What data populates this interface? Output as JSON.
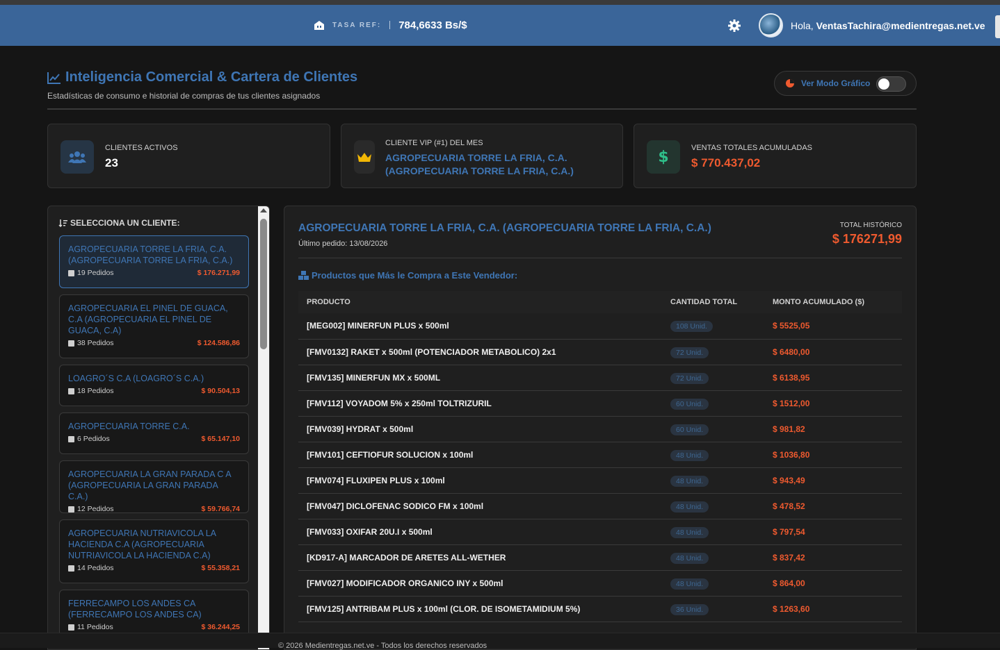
{
  "header": {
    "rate_label": "TASA REF:",
    "rate_value": "784,6633 Bs/$",
    "greeting": "Hola,",
    "user_email": "VentasTachira@medientregas.net.ve"
  },
  "page": {
    "title": "Inteligencia Comercial & Cartera de Clientes",
    "subtitle": "Estadísticas de consumo e historial de compras de tus clientes asignados",
    "toggle_label": "Ver Modo Gráfico",
    "toggle_on": false
  },
  "stats": {
    "clients_label": "CLIENTES ACTIVOS",
    "clients_value": "23",
    "vip_label": "CLIENTE VIP (#1) DEL MES",
    "vip_line1": "AGROPECUARIA TORRE LA FRIA, C.A.",
    "vip_line2": "(AGROPECUARIA TORRE LA FRIA, C.A.)",
    "sales_label": "VENTAS TOTALES ACUMULADAS",
    "sales_value": "$ 770.437,02"
  },
  "client_list": {
    "heading": "SELECCIONA UN CLIENTE:",
    "items": [
      {
        "name": "AGROPECUARIA TORRE LA FRIA, C.A. (AGROPECUARIA TORRE LA FRIA, C.A.)",
        "orders": "19 Pedidos",
        "amount": "$ 176.271,99"
      },
      {
        "name": "AGROPECUARIA EL PINEL DE GUACA, C.A (AGROPECUARIA EL PINEL DE GUACA, C.A)",
        "orders": "38 Pedidos",
        "amount": "$ 124.586,86"
      },
      {
        "name": "LOAGRO´S C.A (LOAGRO´S C.A.)",
        "orders": "18 Pedidos",
        "amount": "$ 90.504,13"
      },
      {
        "name": "AGROPECUARIA TORRE C.A.",
        "orders": "6 Pedidos",
        "amount": "$ 65.147,10"
      },
      {
        "name": "AGROPECUARIA LA GRAN PARADA C A (AGROPECUARIA LA GRAN PARADA C.A.)",
        "orders": "12 Pedidos",
        "amount": "$ 59.766,74"
      },
      {
        "name": "AGROPECUARIA NUTRIAVICOLA LA HACIENDA C.A (AGROPECUARIA NUTRIAVICOLA LA HACIENDA C.A)",
        "orders": "14 Pedidos",
        "amount": "$ 55.358,21"
      },
      {
        "name": "FERRECAMPO LOS ANDES CA (FERRECAMPO LOS ANDES CA)",
        "orders": "11 Pedidos",
        "amount": "$ 36.244,25"
      }
    ]
  },
  "detail": {
    "client_title": "AGROPECUARIA TORRE LA FRIA, C.A. (AGROPECUARIA TORRE LA FRIA, C.A.)",
    "last_order": "Último pedido: 13/08/2026",
    "total_label": "TOTAL HISTÓRICO",
    "total_value": "$ 176271,99",
    "products_heading": "Productos que Más le Compra a Este Vendedor:",
    "columns": [
      "PRODUCTO",
      "CANTIDAD TOTAL",
      "MONTO ACUMULADO ($)"
    ],
    "rows": [
      [
        "[MEG002] MINERFUN PLUS x 500ml",
        "108 Unid.",
        "$ 5525,05"
      ],
      [
        "[FMV0132] RAKET x 500ml (POTENCIADOR METABOLICO) 2x1",
        "72 Unid.",
        "$ 6480,00"
      ],
      [
        "[FMV135] MINERFUN MX x 500ML",
        "72 Unid.",
        "$ 6138,95"
      ],
      [
        "[FMV112] VOYADOM 5% x 250ml TOLTRIZURIL",
        "60 Unid.",
        "$ 1512,00"
      ],
      [
        "[FMV039] HYDRAT x 500ml",
        "60 Unid.",
        "$ 981,82"
      ],
      [
        "[FMV101] CEFTIOFUR SOLUCION x 100ml",
        "48 Unid.",
        "$ 1036,80"
      ],
      [
        "[FMV074] FLUXIPEN PLUS x 100ml",
        "48 Unid.",
        "$ 943,49"
      ],
      [
        "[FMV047] DICLOFENAC SODICO FM x 100ml",
        "48 Unid.",
        "$ 478,52"
      ],
      [
        "[FMV033] OXIFAR 20U.I x 500ml",
        "48 Unid.",
        "$ 797,54"
      ],
      [
        "[KD917-A] MARCADOR DE ARETES ALL-WETHER",
        "48 Unid.",
        "$ 837,42"
      ],
      [
        "[FMV027] MODIFICADOR ORGANICO INY x 500ml",
        "48 Unid.",
        "$ 864,00"
      ],
      [
        "[FMV125] ANTRIBAM PLUS x 100ml (CLOR. DE ISOMETAMIDIUM 5%)",
        "36 Unid.",
        "$ 1263,60"
      ]
    ]
  },
  "footer": {
    "text": "© 2026 Medientregas.net.ve - Todos los derechos reservados"
  }
}
